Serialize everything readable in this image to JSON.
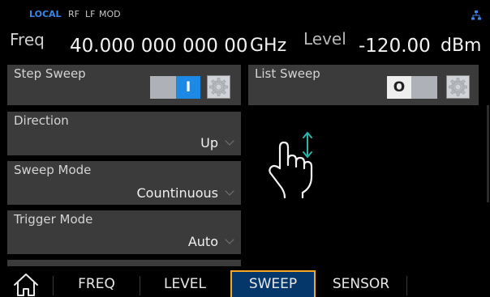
{
  "status_bar": {
    "local": "LOCAL",
    "rf": "RF",
    "lf": "LF",
    "mod": "MOD",
    "network_icon": "network-icon",
    "local_color": "#3a86e8"
  },
  "readout": {
    "freq_label": "Freq",
    "freq_value": "40.000 000 000 00",
    "freq_unit": "GHz",
    "level_label": "Level",
    "level_value": "-120.00",
    "level_unit": "dBm"
  },
  "step_sweep": {
    "title": "Step Sweep",
    "toggle_state": "I",
    "is_on": true
  },
  "list_sweep": {
    "title": "List Sweep",
    "toggle_state": "O",
    "is_on": false
  },
  "direction": {
    "title": "Direction",
    "value": "Up"
  },
  "sweep_mode": {
    "title": "Sweep Mode",
    "value": "Countinuous"
  },
  "trigger_mode": {
    "title": "Trigger Mode",
    "value": "Auto"
  },
  "gesture": {
    "icon": "hand-scroll-icon",
    "arrow_color": "#2ab3a8"
  },
  "nav": {
    "home_icon": "home-icon",
    "tabs": [
      {
        "label": "FREQ",
        "active": false
      },
      {
        "label": "LEVEL",
        "active": false
      },
      {
        "label": "SWEEP",
        "active": true
      },
      {
        "label": "SENSOR",
        "active": false
      }
    ],
    "active_border_color": "#f5a623",
    "active_bg_color": "#06376b"
  },
  "colors": {
    "panel_bg": "#3b3b3b",
    "toggle_on": "#1e88e5"
  }
}
